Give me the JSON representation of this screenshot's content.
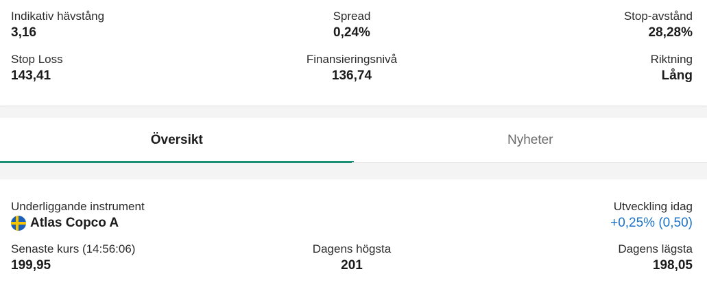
{
  "summary": {
    "leverage": {
      "label": "Indikativ hävstång",
      "value": "3,16"
    },
    "spread": {
      "label": "Spread",
      "value": "0,24%"
    },
    "stop_distance": {
      "label": "Stop-avstånd",
      "value": "28,28%"
    },
    "stop_loss": {
      "label": "Stop Loss",
      "value": "143,41"
    },
    "financing_level": {
      "label": "Finansieringsnivå",
      "value": "136,74"
    },
    "direction": {
      "label": "Riktning",
      "value": "Lång"
    }
  },
  "tabs": [
    {
      "label": "Översikt",
      "active": true
    },
    {
      "label": "Nyheter",
      "active": false
    }
  ],
  "overview": {
    "underlying": {
      "label": "Underliggande instrument",
      "value": "Atlas Copco A",
      "flag_icon": "sweden-flag-icon"
    },
    "change_today": {
      "label": "Utveckling idag",
      "value": "+0,25% (0,50)",
      "color": "#1a73c8"
    },
    "last_price": {
      "label": "Senaste kurs (14:56:06)",
      "value": "199,95"
    },
    "day_high": {
      "label": "Dagens högsta",
      "value": "201"
    },
    "day_low": {
      "label": "Dagens lägsta",
      "value": "198,05"
    }
  },
  "colors": {
    "tab_indicator": "#1b8f73",
    "positive": "#1a73c8",
    "flag_blue": "#1c5fb8",
    "flag_yellow": "#f7c500"
  }
}
